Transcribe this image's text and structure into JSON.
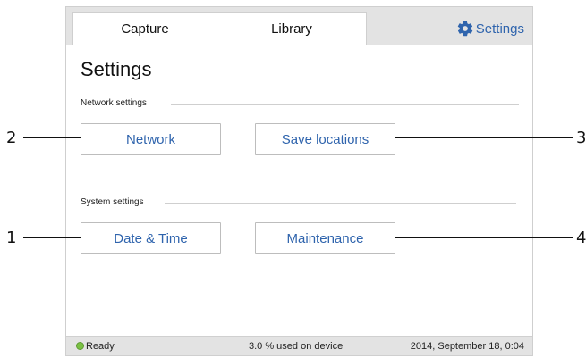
{
  "tabs": {
    "capture": "Capture",
    "library": "Library",
    "settings": "Settings"
  },
  "page": {
    "title": "Settings"
  },
  "sections": {
    "network": {
      "label": "Network settings",
      "buttons": {
        "network": "Network",
        "save_locations": "Save locations"
      }
    },
    "system": {
      "label": "System settings",
      "buttons": {
        "date_time": "Date & Time",
        "maintenance": "Maintenance"
      }
    }
  },
  "status": {
    "ready": "Ready",
    "usage": "3.0 % used on device",
    "datetime": "2014, September 18, 0:04"
  },
  "callouts": {
    "c1": "1",
    "c2": "2",
    "c3": "3",
    "c4": "4"
  },
  "colors": {
    "accent": "#2f64ad",
    "status_ok": "#7ac143"
  },
  "icons": {
    "settings_tab": "gear-icon",
    "status": "status-dot-icon"
  }
}
